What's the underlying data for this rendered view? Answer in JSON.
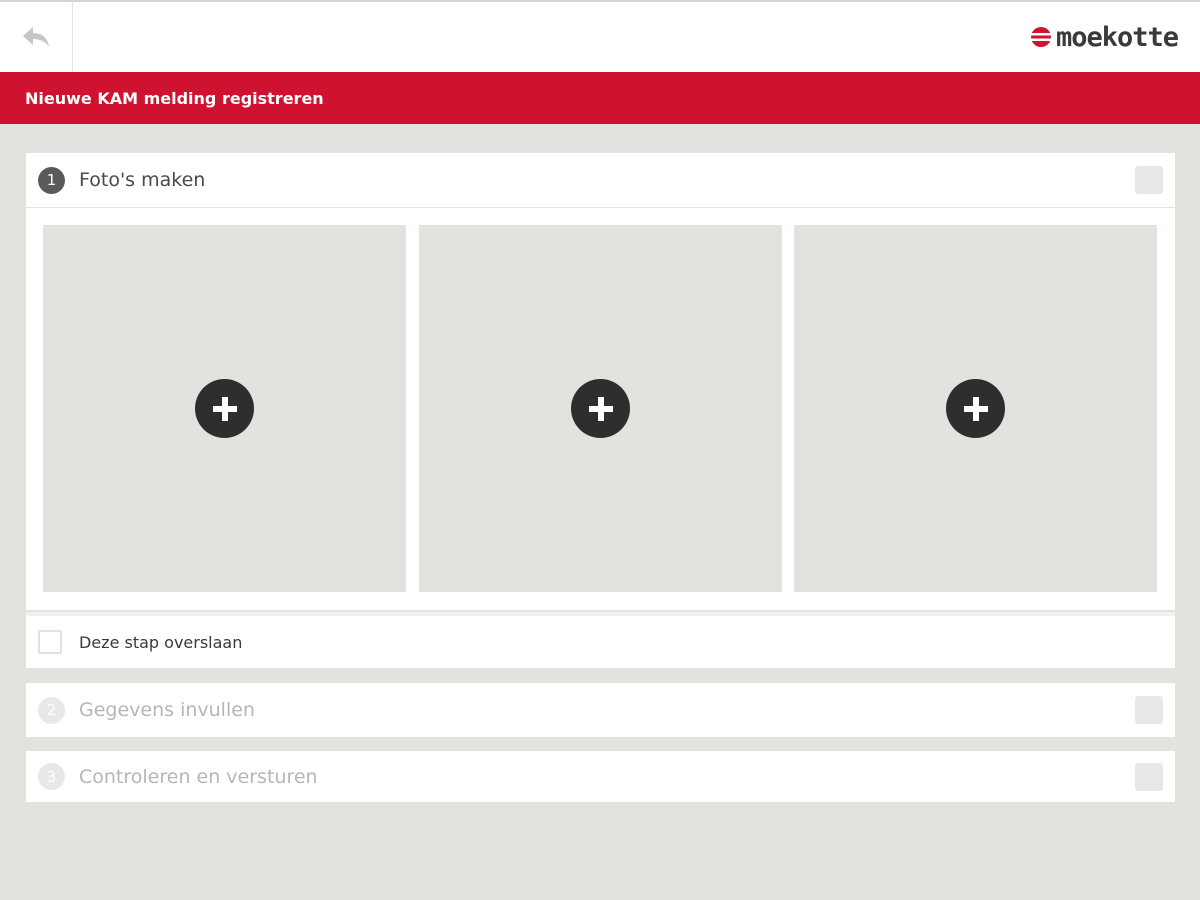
{
  "header": {
    "back_icon": "back-arrow-icon",
    "logo_text": "moekotte",
    "logo_color": "#cf1230"
  },
  "titlebar": {
    "title": "Nieuwe KAM melding registreren",
    "color": "#cf1230"
  },
  "steps": [
    {
      "number": "1",
      "title": "Foto's maken",
      "state": "active"
    },
    {
      "number": "2",
      "title": "Gegevens invullen",
      "state": "inactive"
    },
    {
      "number": "3",
      "title": "Controleren en versturen",
      "state": "inactive"
    }
  ],
  "photos": {
    "slots": [
      {
        "icon": "plus-icon"
      },
      {
        "icon": "plus-icon"
      },
      {
        "icon": "plus-icon"
      }
    ]
  },
  "skip": {
    "label": "Deze stap overslaan",
    "checked": false
  }
}
